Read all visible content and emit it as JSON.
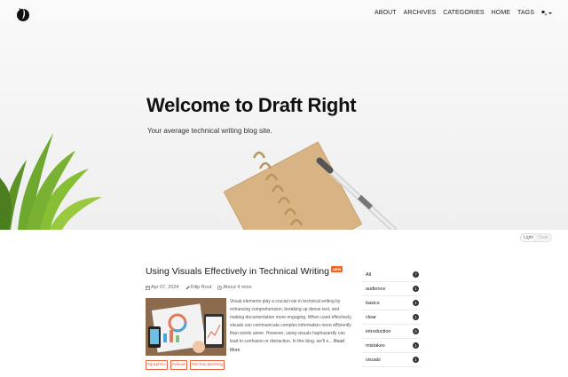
{
  "nav": {
    "items": [
      "ABOUT",
      "ARCHIVES",
      "CATEGORIES",
      "HOME",
      "TAGS"
    ],
    "lang_icon": "language-icon"
  },
  "hero": {
    "title": "Welcome to Draft Right",
    "subtitle": "Your average technical writing blog site."
  },
  "theme_toggle": {
    "light": "Light",
    "dark": "Dark"
  },
  "post": {
    "title": "Using Visuals Effectively in Technical Writing",
    "badge": "NEW",
    "date": "Apr 07, 2024",
    "author": "Dilip Rout",
    "read_time": "About 4 mins",
    "excerpt": "Visual elements play a crucial role in technical writing by enhancing comprehension, breaking up dense text, and making documentation more engaging. When used effectively, visuals can communicate complex information more efficiently than words alone. However, using visuals haphazardly can lead to confusion or distraction. In this blog, we'll e...",
    "read_more": "Read More",
    "tags": [
      "#graphics",
      "#visual",
      "#technicalwriting"
    ]
  },
  "categories": [
    {
      "label": "All",
      "count": "7"
    },
    {
      "label": "audience",
      "count": "1"
    },
    {
      "label": "basics",
      "count": "1"
    },
    {
      "label": "clear",
      "count": "1"
    },
    {
      "label": "introduction",
      "count": "0"
    },
    {
      "label": "mistakes",
      "count": "1"
    },
    {
      "label": "visuals",
      "count": "1"
    }
  ],
  "colors": {
    "accent": "#f26522",
    "tag": "#e8603c"
  }
}
